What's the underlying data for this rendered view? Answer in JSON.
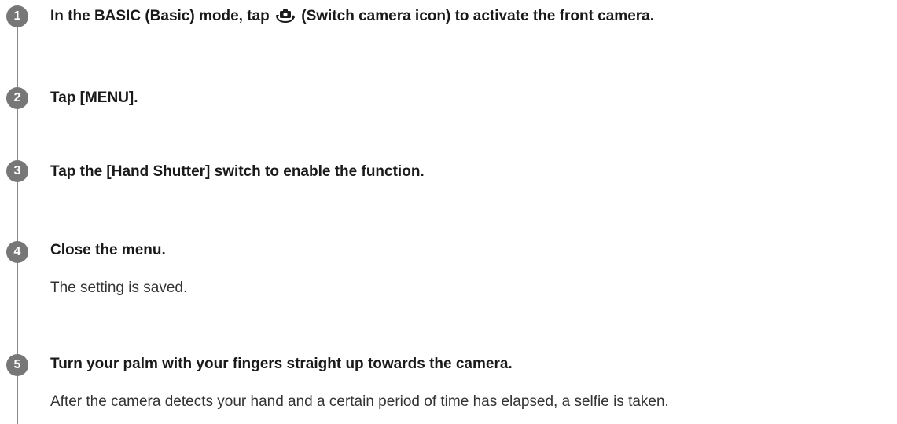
{
  "steps": [
    {
      "number": "1",
      "title_before_icon": "In the BASIC (Basic) mode, tap",
      "icon": "switch-camera-icon",
      "title_after_icon": "(Switch camera icon) to activate the front camera."
    },
    {
      "number": "2",
      "title": "Tap [MENU]."
    },
    {
      "number": "3",
      "title": "Tap the [Hand Shutter] switch to enable the function."
    },
    {
      "number": "4",
      "title": "Close the menu.",
      "description": "The setting is saved."
    },
    {
      "number": "5",
      "title": "Turn your palm with your fingers straight up towards the camera.",
      "description": "After the camera detects your hand and a certain period of time has elapsed, a selfie is taken."
    }
  ],
  "colors": {
    "step_circle": "#777777",
    "rail": "#8a8a8a",
    "text": "#1a1a1a"
  }
}
